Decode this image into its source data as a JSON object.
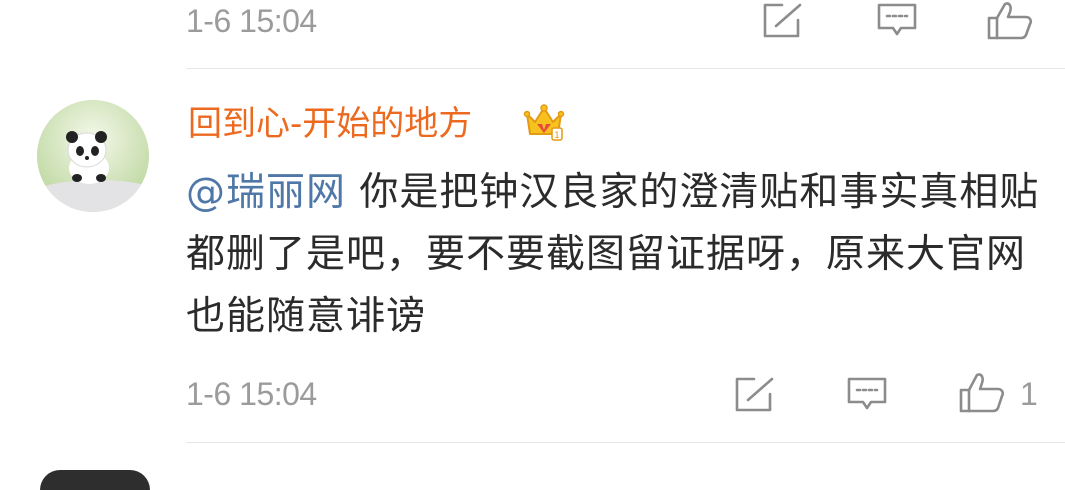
{
  "previous_comment": {
    "time": "1-6 15:04"
  },
  "comment": {
    "username": "回到心-开始的地方",
    "badge_icon": "crown-vip-icon",
    "mention": "@瑞丽网",
    "text": " 你是把钟汉良家的澄清贴和事实真相贴都删了是吧，要不要截图留证据呀，原来大官网也能随意诽谤",
    "time": "1-6 15:04",
    "like_count": "1"
  },
  "icons": {
    "repost": "share-edit-icon",
    "comment": "comment-icon",
    "like": "thumbs-up-icon"
  },
  "colors": {
    "username": "#ec6a20",
    "mention": "#4f78a8",
    "text": "#2b2b2b",
    "meta": "#9b9b9b"
  }
}
